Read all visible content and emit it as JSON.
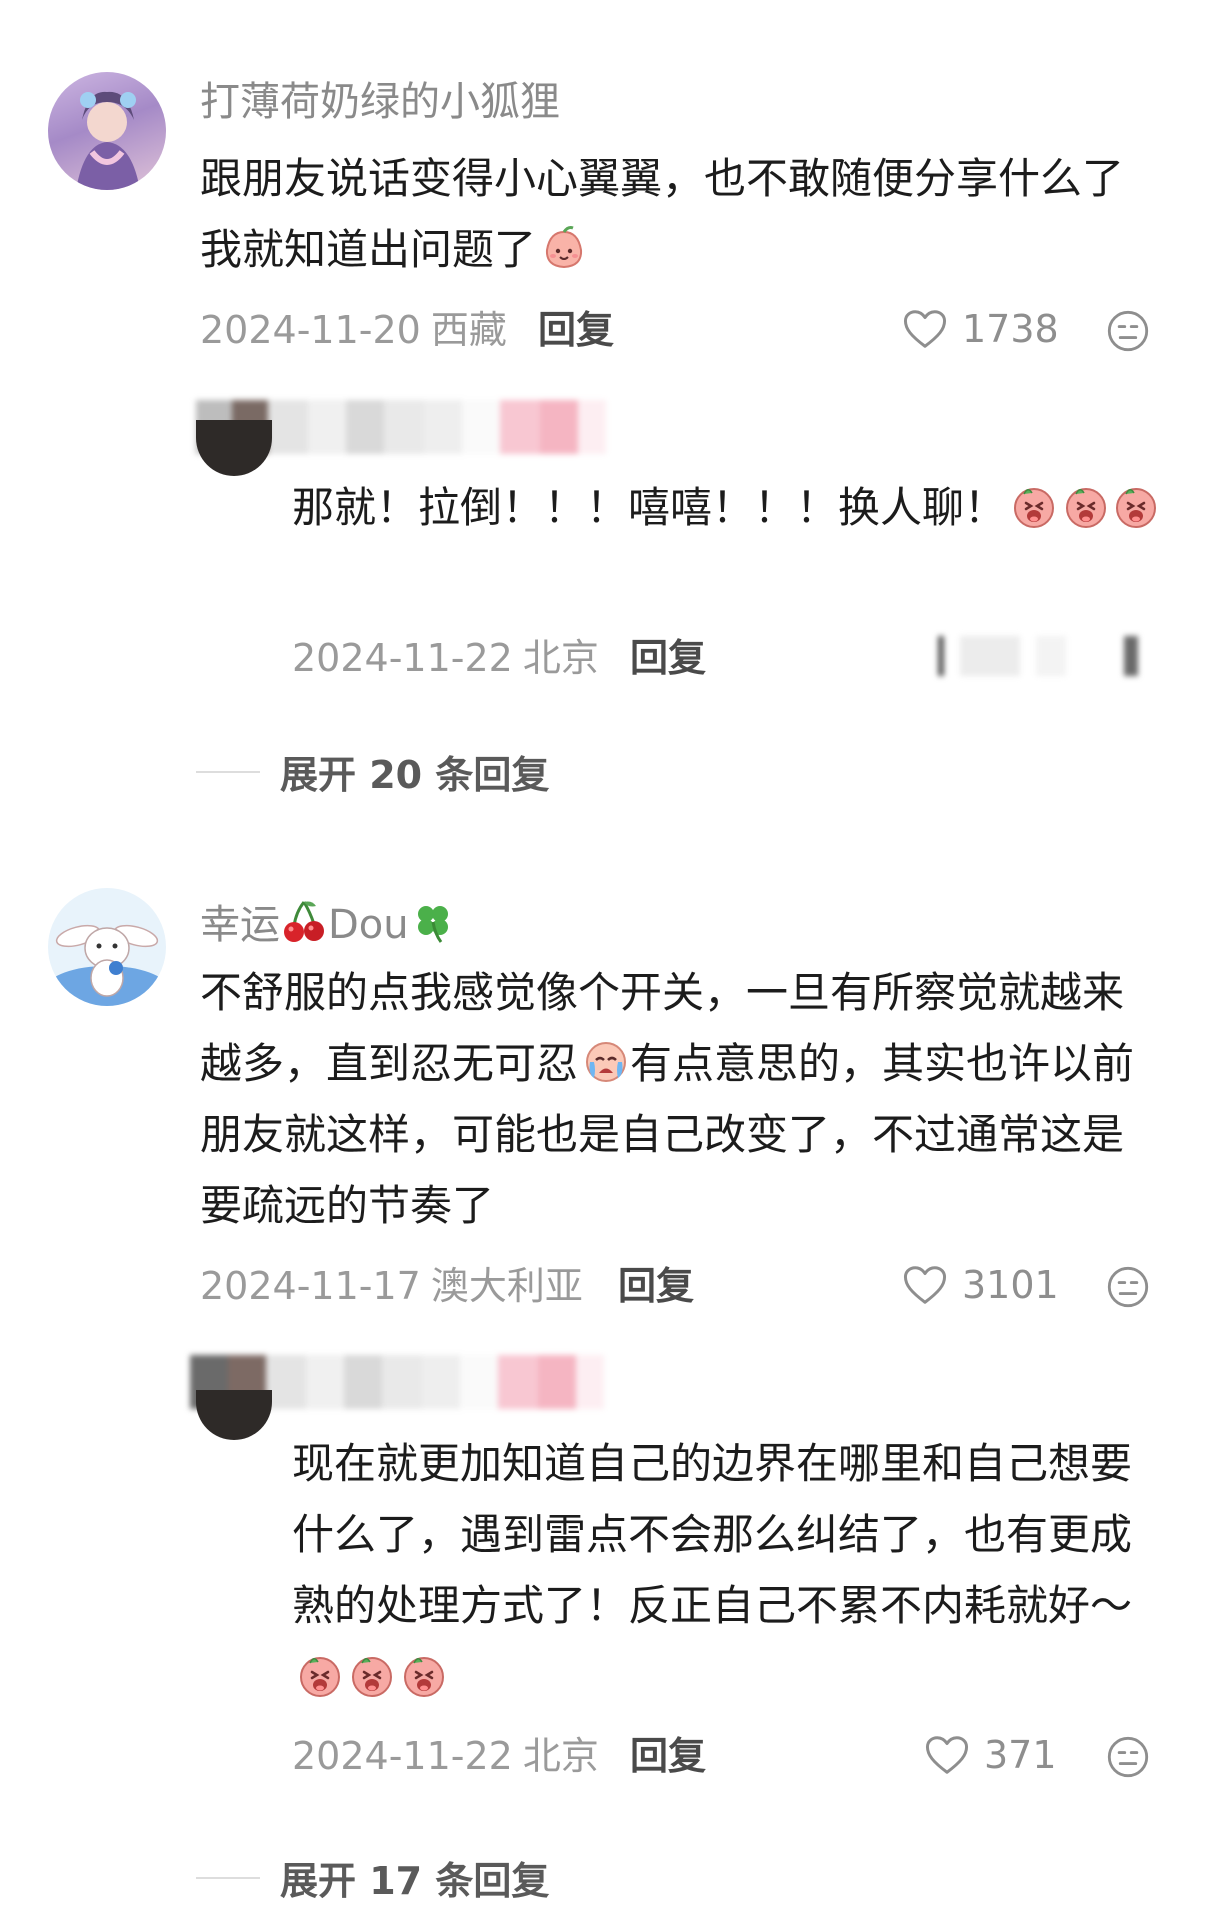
{
  "comments": [
    {
      "username": "打薄荷奶绿的小狐狸",
      "text": "跟朋友说话变得小心翼翼，也不敢随便分享什么了我就知道出问题了",
      "date": "2024-11-20",
      "location": "西藏",
      "reply_label": "回复",
      "likes": "1738",
      "reply": {
        "text": "那就！拉倒！！！嘻嘻！！！换人聊！",
        "date": "2024-11-22",
        "location": "北京",
        "reply_label": "回复"
      },
      "expand_label": "展开 20 条回复"
    },
    {
      "username_prefix": "幸运",
      "username_suffix": "Dou",
      "text_part1": "不舒服的点我感觉像个开关，一旦有所察觉就越来越多，直到忍无可忍",
      "text_part2": "有点意思的，其实也许以前朋友就这样，可能也是自己改变了，不过通常这是要疏远的节奏了",
      "date": "2024-11-17",
      "location": "澳大利亚",
      "reply_label": "回复",
      "likes": "3101",
      "reply": {
        "text": "现在就更加知道自己的边界在哪里和自己想要什么了，遇到雷点不会那么纠结了，也有更成熟的处理方式了！反正自己不累不内耗就好～",
        "date": "2024-11-22",
        "location": "北京",
        "reply_label": "回复",
        "likes": "371"
      },
      "expand_label": "展开 17 条回复"
    }
  ],
  "icons": {
    "like": "heart-outline-icon",
    "dislike": "meh-face-icon",
    "emoji_reply": "laughing-pig-emoji",
    "emoji_smile": "smiling-peach-emoji",
    "emoji_cry": "crying-face-emoji",
    "cherry": "cherry-icon",
    "clover": "four-leaf-clover-icon"
  },
  "colors": {
    "username": "#8a8a8a",
    "meta": "#9a9a9a",
    "text": "#1c1c1c",
    "emoji_pink": "#f39a9a"
  }
}
